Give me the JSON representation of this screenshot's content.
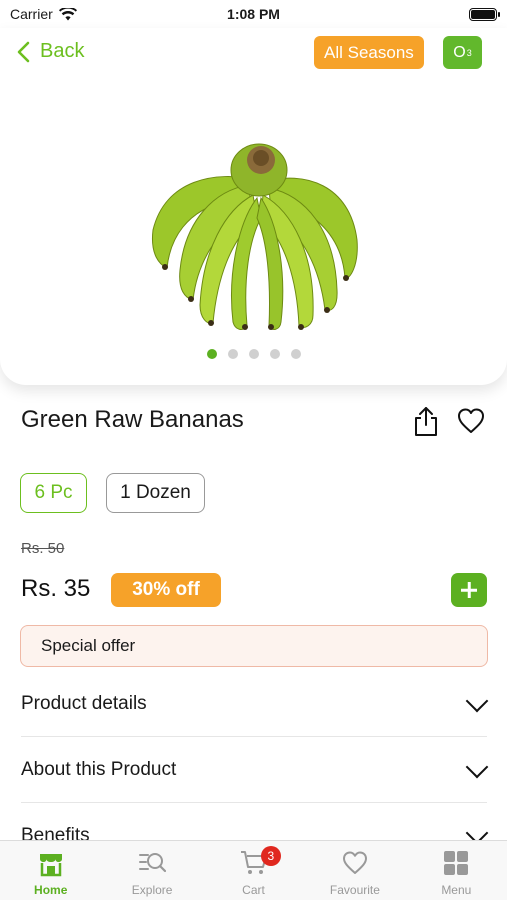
{
  "status_bar": {
    "carrier": "Carrier",
    "time": "1:08 PM"
  },
  "header": {
    "back_label": "Back",
    "season_label": "All Seasons",
    "badge_label": "O",
    "badge_sub": "3"
  },
  "carousel": {
    "total": 5,
    "active_index": 0
  },
  "product": {
    "title": "Green Raw Bananas",
    "variants": [
      "6 Pc",
      "1 Dozen"
    ],
    "selected_variant": "6 Pc",
    "mrp": "Rs. 50",
    "price": "Rs. 35",
    "discount": "30% off",
    "special_offer": "Special offer"
  },
  "sections": [
    "Product details",
    "About this Product",
    "Benefits"
  ],
  "tabbar": {
    "items": [
      "Home",
      "Explore",
      "Cart",
      "Favourite",
      "Menu"
    ],
    "active": "Home",
    "cart_count": "3"
  },
  "colors": {
    "accent": "#5cb021",
    "orange": "#f6a229",
    "badge_red": "#e0281f"
  }
}
